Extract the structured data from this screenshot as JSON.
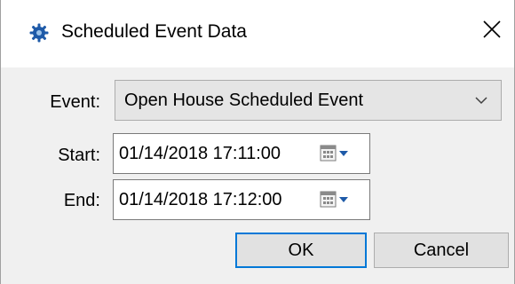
{
  "window": {
    "title": "Scheduled Event Data",
    "title_icon": "gear-icon",
    "close_icon": "close-icon"
  },
  "form": {
    "event_label": "Event:",
    "event_value": "Open House Scheduled Event",
    "start_label": "Start:",
    "start_value": "01/14/2018 17:11:00",
    "end_label": "End:",
    "end_value": "01/14/2018 17:12:00",
    "calendar_icon": "calendar-icon"
  },
  "buttons": {
    "ok_label": "OK",
    "cancel_label": "Cancel"
  },
  "colors": {
    "focus_border": "#0078d7",
    "title_icon_color": "#1e5aa8"
  }
}
